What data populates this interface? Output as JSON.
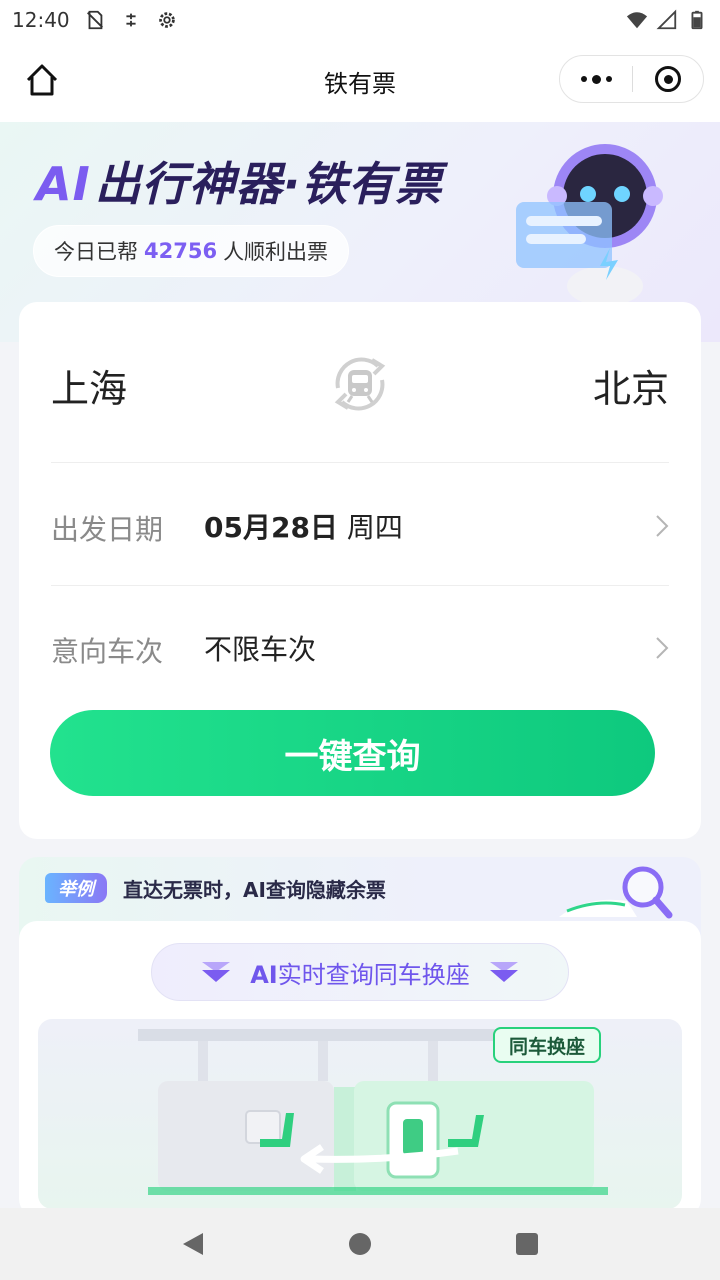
{
  "status_bar": {
    "time": "12:40"
  },
  "title_bar": {
    "title": "铁有票"
  },
  "hero": {
    "title_ai": "AI",
    "title_rest": "出行神器·铁有票",
    "pill_prefix": "今日已帮",
    "pill_count": "42756",
    "pill_suffix": "人顺利出票"
  },
  "search": {
    "from_city": "上海",
    "to_city": "北京",
    "date_label": "出发日期",
    "date_value": "05月28日",
    "weekday": "周四",
    "train_label": "意向车次",
    "train_value": "不限车次",
    "cta_label": "一键查询"
  },
  "example": {
    "tag": "举例",
    "title": "直达无票时，AI查询隐藏余票",
    "sub_ai": "AI",
    "sub_rest": "实时查询同车换座",
    "badge": "同车换座"
  },
  "colors": {
    "accent_green": "#10c980",
    "accent_purple": "#7b5cf0"
  }
}
